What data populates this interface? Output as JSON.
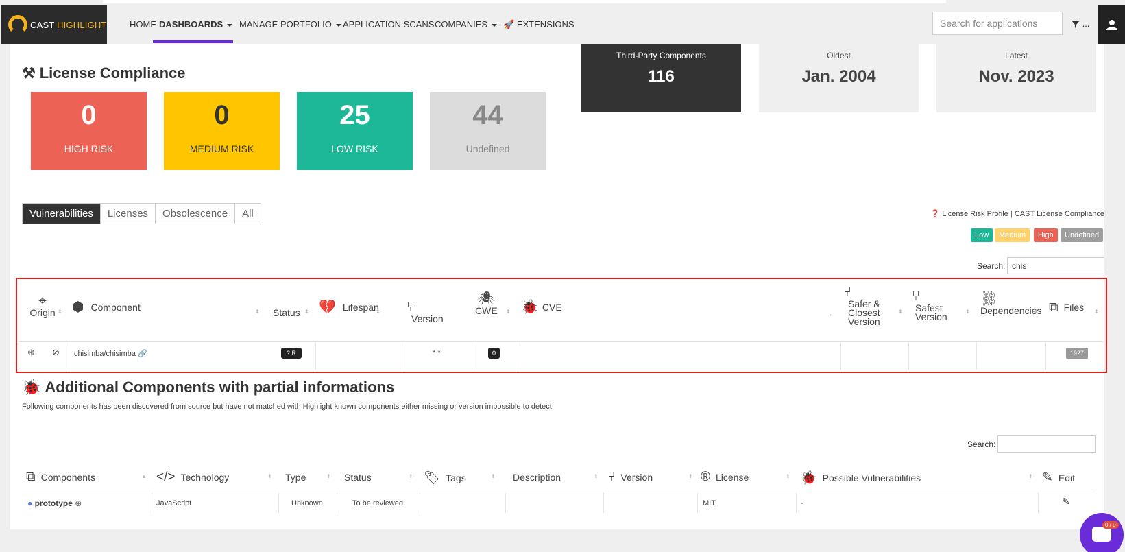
{
  "nav": {
    "logo_text_a": "CAST",
    "logo_text_b": "HIGHLIGHT",
    "items": [
      {
        "label": "HOME"
      },
      {
        "label": "DASHBOARDS"
      },
      {
        "label": "MANAGE PORTFOLIO"
      },
      {
        "label": "APPLICATION SCANS"
      },
      {
        "label": "COMPANIES"
      },
      {
        "label": "EXTENSIONS"
      }
    ],
    "search_placeholder": "Search for applications",
    "filter_dots": "..."
  },
  "license": {
    "title": "License Compliance",
    "cards": [
      {
        "value": "0",
        "label": "HIGH RISK",
        "color": "#ec6355"
      },
      {
        "value": "0",
        "label": "MEDIUM RISK",
        "color": "#ffc600"
      },
      {
        "value": "25",
        "label": "LOW RISK",
        "color": "#1cb898"
      },
      {
        "value": "44",
        "label": "Undefined",
        "color": "#dcdcdc"
      }
    ]
  },
  "stats": [
    {
      "label": "Third-Party Components",
      "value": "116"
    },
    {
      "label": "Oldest",
      "value": "Jan. 2004"
    },
    {
      "label": "Latest",
      "value": "Nov. 2023"
    }
  ],
  "tabs": [
    "Vulnerabilities",
    "Licenses",
    "Obsolescence",
    "All"
  ],
  "help_link": "License Risk Profile | CAST License Compliance",
  "legend": [
    {
      "label": "Low",
      "color": "#1cb898"
    },
    {
      "label": "Medium",
      "color": "#ffd26b"
    },
    {
      "label": "High",
      "color": "#ec6355"
    },
    {
      "label": "Undefined",
      "color": "#9e9e9e"
    }
  ],
  "table1": {
    "search_label": "Search:",
    "search_value": "chis",
    "headers": {
      "origin": "Origin",
      "component": "Component",
      "status": "Status",
      "lifespan": "Lifespan",
      "version": "Version",
      "cwe": "CWE",
      "cve": "CVE",
      "safer_1": "Safer &",
      "safer_2": "Closest",
      "safer_3": "Version",
      "safest_1": "Safest",
      "safest_2": "Version",
      "dependencies": "Dependencies",
      "files": "Files"
    },
    "row": {
      "component": "chisimba/chisimba",
      "status": "R",
      "version": "* *",
      "cwe": "0",
      "files": "1927"
    }
  },
  "additional": {
    "title": "Additional Components with partial informations",
    "subtitle": "Following components has been discovered from source but have not matched with Highlight known components either missing or version impossible to detect",
    "search_label": "Search:",
    "headers": {
      "components": "Components",
      "technology": "Technology",
      "type": "Type",
      "status": "Status",
      "tags": "Tags",
      "description": "Description",
      "version": "Version",
      "license": "License",
      "possible_vulns": "Possible Vulnerabilities",
      "edit": "Edit"
    },
    "row": {
      "name": "prototype",
      "technology": "JavaScript",
      "type": "Unknown",
      "status": "To be reviewed",
      "license": "MIT",
      "possible_vulns": "-"
    }
  },
  "chat": {
    "count": "0 / 0"
  }
}
